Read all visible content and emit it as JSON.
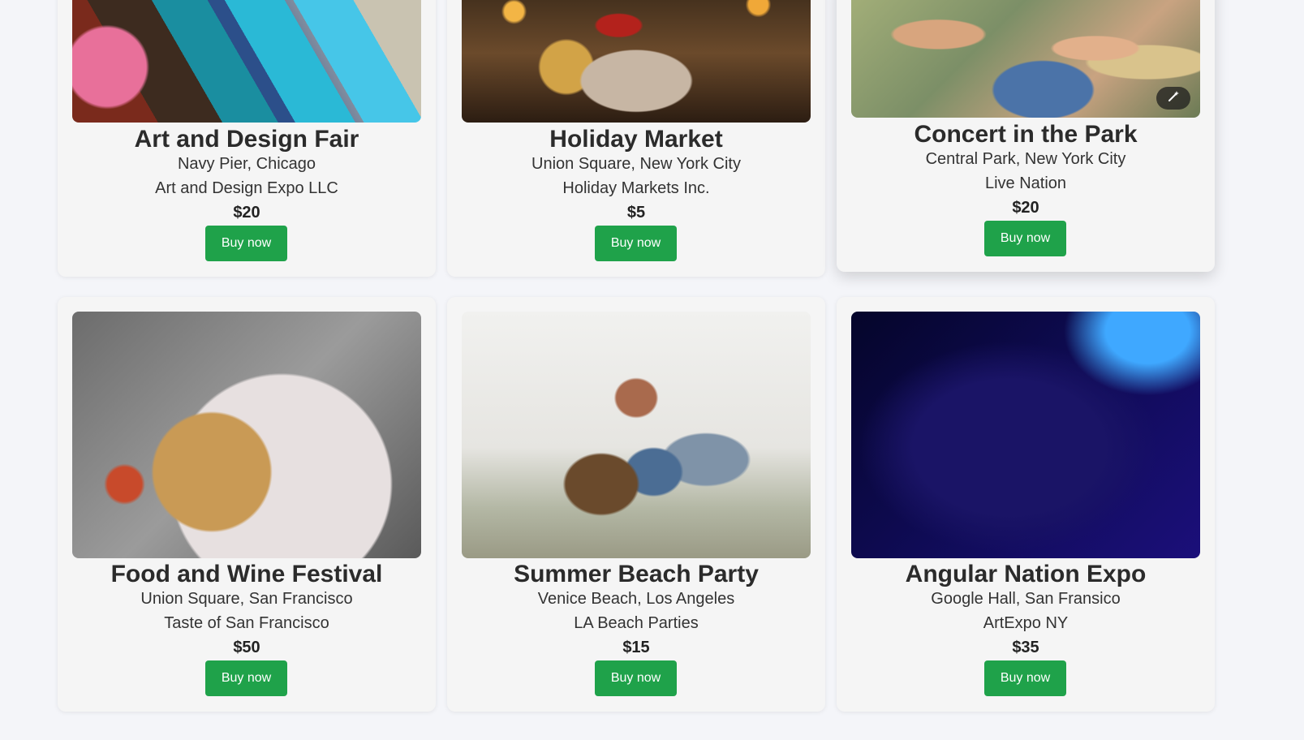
{
  "events": [
    {
      "title": "Art and Design Fair",
      "location": "Navy Pier, Chicago",
      "organizer": "Art and Design Expo LLC",
      "price": "$20",
      "button": "Buy now",
      "image": "paint-brushes-image"
    },
    {
      "title": "Holiday Market",
      "location": "Union Square, New York City",
      "organizer": "Holiday Markets Inc.",
      "price": "$5",
      "button": "Buy now",
      "image": "holiday-market-image"
    },
    {
      "title": "Concert in the Park",
      "location": "Central Park, New York City",
      "organizer": "Live Nation",
      "price": "$20",
      "button": "Buy now",
      "image": "concert-crowd-image",
      "overlay_icon": "magic-wand-icon"
    },
    {
      "title": "Food and Wine Festival",
      "location": "Union Square, San Francisco",
      "organizer": "Taste of San Francisco",
      "price": "$50",
      "button": "Buy now",
      "image": "pasta-plate-image"
    },
    {
      "title": "Summer Beach Party",
      "location": "Venice Beach, Los Angeles",
      "organizer": "LA Beach Parties",
      "price": "$15",
      "button": "Buy now",
      "image": "beach-friends-image"
    },
    {
      "title": "Angular Nation Expo",
      "location": "Google Hall, San Fransico",
      "organizer": "ArtExpo NY",
      "price": "$35",
      "button": "Buy now",
      "image": "code-laptop-image"
    }
  ],
  "colors": {
    "page_background": "#f4f5f9",
    "card_background": "#f5f5f5",
    "button_green": "#1fa24a",
    "button_text": "#ffffff"
  }
}
